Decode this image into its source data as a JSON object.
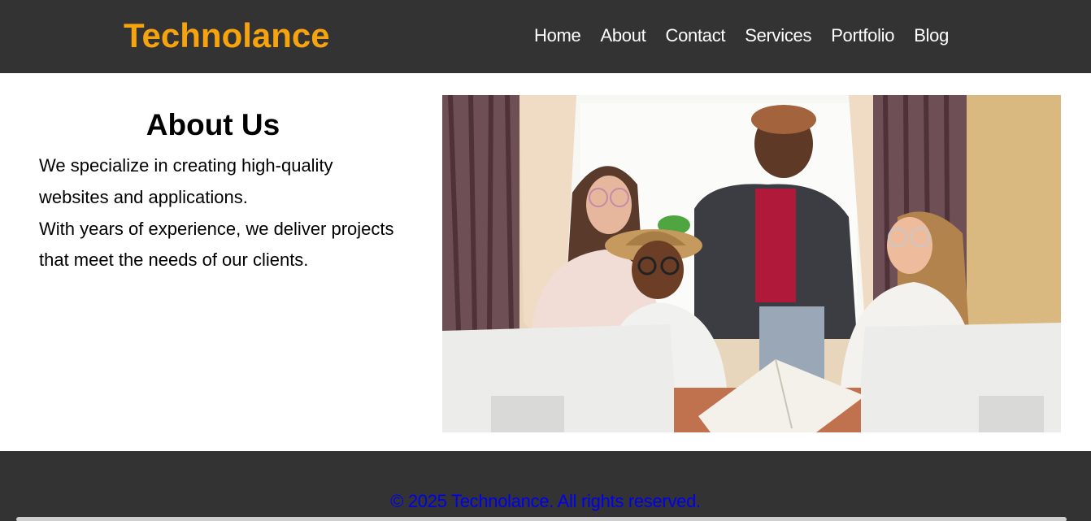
{
  "header": {
    "brand": "Technolance",
    "nav": [
      "Home",
      "About",
      "Contact",
      "Services",
      "Portfolio",
      "Blog"
    ]
  },
  "about": {
    "title": "About Us",
    "paragraph1": "We specialize in creating high-quality websites and applications.",
    "paragraph2": "With years of experience, we deliver projects that meet the needs of our clients."
  },
  "footer": {
    "copyright": "© 2025 Technolance. All rights reserved."
  },
  "colors": {
    "header_bg": "#333333",
    "brand": "#f5a30f",
    "nav_text": "#ffffff",
    "footer_link": "#0000ee"
  }
}
